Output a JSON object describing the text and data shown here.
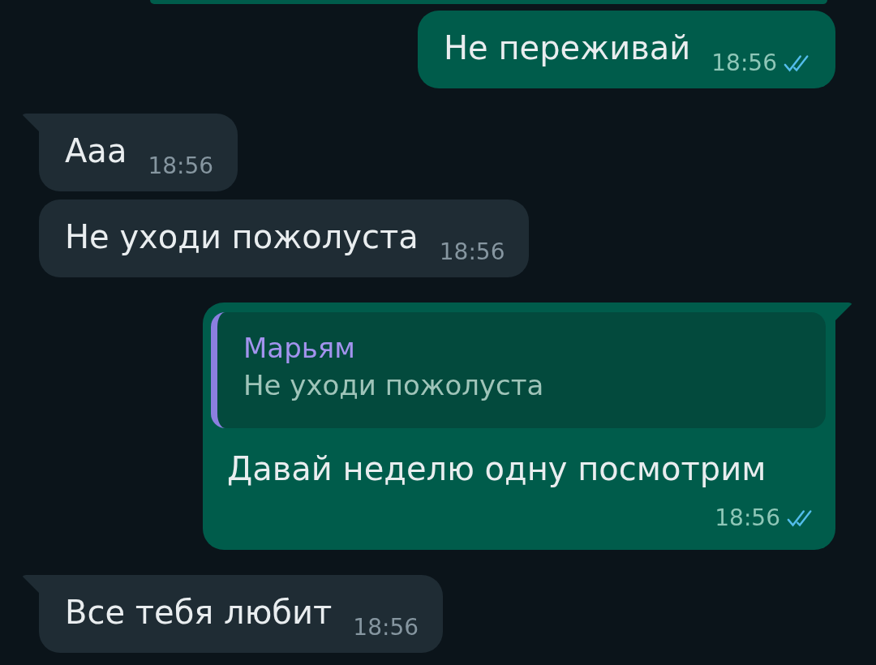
{
  "messages": [
    {
      "outgoing": true,
      "tail": false,
      "text": "Не переживай",
      "time": "18:56",
      "read": true
    },
    {
      "outgoing": false,
      "tail": true,
      "text": "Ааа",
      "time": "18:56"
    },
    {
      "outgoing": false,
      "tail": false,
      "text": "Не уходи пожолуста",
      "time": "18:56"
    },
    {
      "outgoing": true,
      "tail": true,
      "reply": {
        "author": "Марьям",
        "text": "Не уходи пожолуста"
      },
      "text": "Давай неделю одну посмотрим",
      "time": "18:56",
      "read": true
    },
    {
      "outgoing": false,
      "tail": true,
      "text": "Все тебя любит",
      "time": "18:56"
    }
  ]
}
